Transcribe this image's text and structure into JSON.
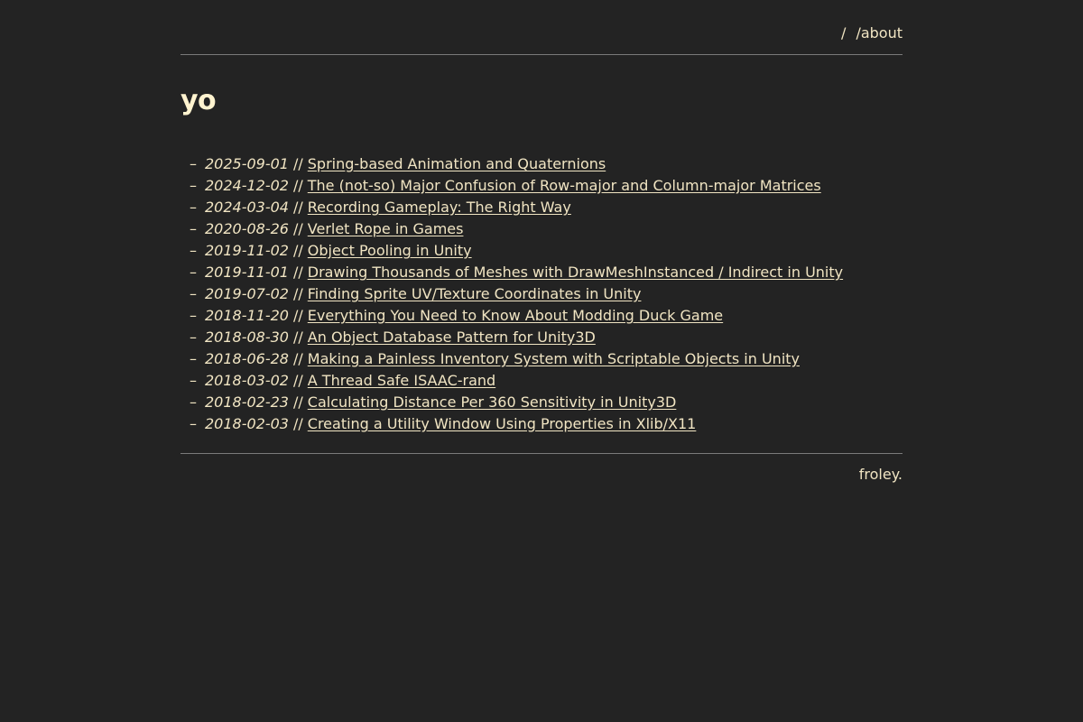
{
  "nav": {
    "home_label": "/",
    "about_label": "/about"
  },
  "page": {
    "title": "yo"
  },
  "posts": [
    {
      "dash": "–",
      "date": "2025-09-01",
      "sep": "//",
      "title": "Spring-based Animation and Quaternions"
    },
    {
      "dash": "–",
      "date": "2024-12-02",
      "sep": "//",
      "title": "The (not-so) Major Confusion of Row-major and Column-major Matrices"
    },
    {
      "dash": "–",
      "date": "2024-03-04",
      "sep": "//",
      "title": "Recording Gameplay: The Right Way"
    },
    {
      "dash": "–",
      "date": "2020-08-26",
      "sep": "//",
      "title": "Verlet Rope in Games"
    },
    {
      "dash": "–",
      "date": "2019-11-02",
      "sep": "//",
      "title": "Object Pooling in Unity"
    },
    {
      "dash": "–",
      "date": "2019-11-01",
      "sep": "//",
      "title": "Drawing Thousands of Meshes with DrawMeshInstanced / Indirect in Unity"
    },
    {
      "dash": "–",
      "date": "2019-07-02",
      "sep": "//",
      "title": "Finding Sprite UV/Texture Coordinates in Unity"
    },
    {
      "dash": "–",
      "date": "2018-11-20",
      "sep": "//",
      "title": "Everything You Need to Know About Modding Duck Game"
    },
    {
      "dash": "–",
      "date": "2018-08-30",
      "sep": "//",
      "title": "An Object Database Pattern for Unity3D"
    },
    {
      "dash": "–",
      "date": "2018-06-28",
      "sep": "//",
      "title": "Making a Painless Inventory System with Scriptable Objects in Unity"
    },
    {
      "dash": "–",
      "date": "2018-03-02",
      "sep": "//",
      "title": "A Thread Safe ISAAC-rand"
    },
    {
      "dash": "–",
      "date": "2018-02-23",
      "sep": "//",
      "title": "Calculating Distance Per 360 Sensitivity in Unity3D"
    },
    {
      "dash": "–",
      "date": "2018-02-03",
      "sep": "//",
      "title": "Creating a Utility Window Using Properties in Xlib/X11"
    }
  ],
  "footer": {
    "text": "froley."
  },
  "colors": {
    "background": "#232323",
    "text": "#f1e5c3",
    "rule": "#7a7a7a"
  }
}
